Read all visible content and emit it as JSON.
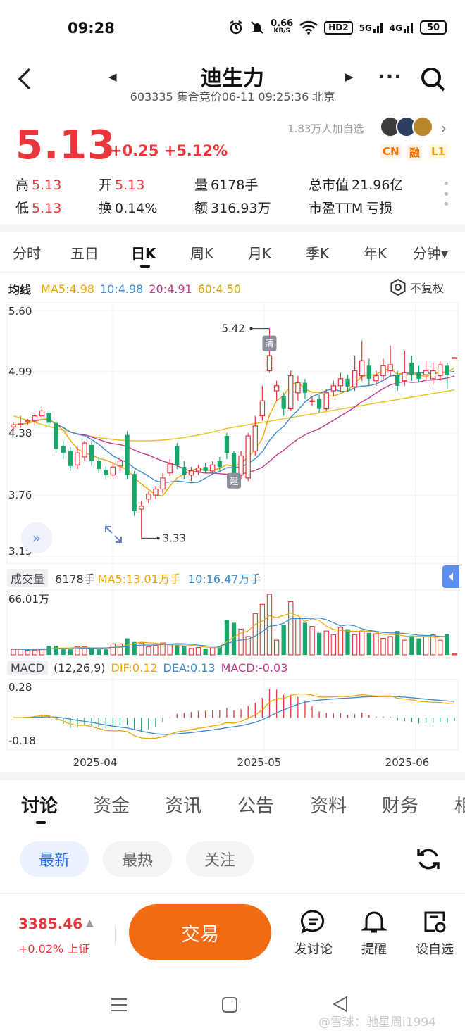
{
  "status_bar": {
    "time": "09:28",
    "net_speed": "0.66",
    "net_unit": "KB/S",
    "hd": "HD2",
    "sig1": "5G",
    "sig2": "4G",
    "battery": "50",
    "icons": [
      "alarm-icon",
      "mute-icon",
      "wifi-icon"
    ]
  },
  "header": {
    "stock_name": "迪生力",
    "subtitle": "603335 集合竞价06-11 09:25:36 北京"
  },
  "quote": {
    "price": "5.13",
    "change": "+0.25 +5.12%",
    "followers": "1.83万人加自选",
    "tags": [
      "CN",
      "融",
      "L1"
    ],
    "stats": {
      "high_label": "高",
      "high": "5.13",
      "open_label": "开",
      "open": "5.13",
      "volume_label": "量",
      "volume": "6178手",
      "mktcap_label": "总市值",
      "mktcap": "21.96亿",
      "low_label": "低",
      "low": "5.13",
      "turnover_label": "换",
      "turnover": "0.14%",
      "amount_label": "额",
      "amount": "316.93万",
      "pe_label": "市盈TTM",
      "pe": "亏损"
    },
    "colors": {
      "up": "#e8363a",
      "down": "#1aa56b"
    }
  },
  "period_tabs": [
    "分时",
    "五日",
    "日K",
    "周K",
    "月K",
    "季K",
    "年K",
    "分钟▾"
  ],
  "active_period": "日K",
  "ma_legend": {
    "label": "均线",
    "ma5": "MA5:4.98",
    "ma10": "10:4.98",
    "ma20": "20:4.91",
    "ma60": "60:4.50",
    "colors": {
      "ma5": "#f0a400",
      "ma10": "#3a8ad0",
      "ma20": "#c43a8c",
      "ma60": "#e8c020"
    },
    "adjust": "不复权"
  },
  "chart_data": {
    "type": "candlestick",
    "y_axis_labels": [
      "5.60",
      "4.99",
      "4.38",
      "3.76",
      "3.15"
    ],
    "ylim": [
      3.15,
      5.6
    ],
    "max_marker": "5.42",
    "min_marker": "3.33",
    "badges": [
      "清",
      "建"
    ],
    "x_labels": [
      "2025-04",
      "2025-05",
      "2025-06"
    ],
    "candles": [
      [
        4.44,
        4.46,
        4.4,
        4.48
      ],
      [
        4.47,
        4.47,
        4.43,
        4.55
      ],
      [
        4.49,
        4.5,
        4.46,
        4.52
      ],
      [
        4.5,
        4.55,
        4.45,
        4.58
      ],
      [
        4.55,
        4.6,
        4.5,
        4.65
      ],
      [
        4.58,
        4.48,
        4.45,
        4.6
      ],
      [
        4.48,
        4.22,
        4.18,
        4.5
      ],
      [
        4.25,
        4.18,
        4.12,
        4.3
      ],
      [
        4.2,
        4.05,
        4.0,
        4.24
      ],
      [
        4.06,
        4.18,
        4.02,
        4.24
      ],
      [
        4.14,
        4.28,
        4.1,
        4.3
      ],
      [
        4.26,
        4.1,
        4.05,
        4.3
      ],
      [
        4.1,
        4.02,
        3.98,
        4.14
      ],
      [
        4.01,
        3.96,
        3.92,
        4.05
      ],
      [
        3.96,
        4.04,
        3.94,
        4.08
      ],
      [
        4.05,
        4.1,
        4.0,
        4.14
      ],
      [
        4.36,
        3.96,
        3.92,
        4.4
      ],
      [
        3.97,
        3.6,
        3.55,
        4.0
      ],
      [
        3.62,
        3.65,
        3.33,
        3.7
      ],
      [
        3.72,
        3.77,
        3.68,
        3.8
      ],
      [
        3.76,
        3.82,
        3.72,
        3.85
      ],
      [
        3.82,
        3.93,
        3.78,
        3.98
      ],
      [
        3.98,
        4.07,
        3.95,
        4.12
      ],
      [
        4.25,
        4.06,
        4.02,
        4.28
      ],
      [
        4.04,
        3.96,
        3.92,
        4.1
      ],
      [
        3.96,
        4.0,
        3.9,
        4.04
      ],
      [
        4.0,
        4.03,
        3.96,
        4.06
      ],
      [
        4.04,
        4.0,
        3.98,
        4.08
      ],
      [
        4.0,
        4.06,
        3.97,
        4.1
      ],
      [
        4.1,
        4.04,
        4.0,
        4.14
      ],
      [
        4.35,
        4.18,
        4.12,
        4.38
      ],
      [
        4.18,
        3.96,
        3.92,
        4.2
      ],
      [
        3.96,
        4.15,
        3.92,
        4.2
      ],
      [
        3.93,
        4.35,
        3.9,
        4.38
      ],
      [
        4.2,
        4.45,
        4.15,
        4.55
      ],
      [
        4.55,
        4.7,
        4.5,
        4.85
      ],
      [
        5.0,
        5.15,
        4.98,
        5.42
      ],
      [
        4.8,
        4.85,
        4.7,
        4.9
      ],
      [
        4.75,
        4.62,
        4.55,
        4.78
      ],
      [
        4.62,
        4.95,
        4.6,
        5.0
      ],
      [
        4.78,
        4.88,
        4.7,
        4.95
      ],
      [
        4.88,
        4.78,
        4.72,
        4.92
      ],
      [
        4.7,
        4.7,
        4.65,
        4.75
      ],
      [
        4.72,
        4.62,
        4.58,
        4.76
      ],
      [
        4.62,
        4.78,
        4.6,
        4.82
      ],
      [
        4.8,
        4.85,
        4.75,
        4.9
      ],
      [
        4.85,
        4.92,
        4.8,
        4.98
      ],
      [
        4.92,
        4.84,
        4.8,
        4.96
      ],
      [
        4.84,
        5.0,
        4.8,
        5.15
      ],
      [
        4.95,
        5.1,
        4.9,
        5.3
      ],
      [
        5.05,
        4.92,
        4.85,
        5.12
      ],
      [
        4.9,
        4.95,
        4.85,
        5.0
      ],
      [
        4.95,
        5.05,
        4.9,
        5.12
      ],
      [
        5.0,
        5.06,
        4.95,
        5.25
      ],
      [
        4.96,
        4.85,
        4.8,
        5.0
      ],
      [
        4.9,
        4.98,
        4.85,
        5.2
      ],
      [
        5.08,
        4.96,
        4.9,
        5.15
      ],
      [
        4.98,
        4.92,
        4.88,
        5.05
      ],
      [
        4.96,
        5.0,
        4.9,
        5.1
      ],
      [
        4.92,
        5.0,
        4.86,
        5.08
      ],
      [
        4.95,
        5.06,
        4.9,
        5.1
      ],
      [
        5.05,
        4.96,
        4.82,
        5.08
      ],
      [
        5.13,
        5.13,
        5.13,
        5.13
      ]
    ]
  },
  "volume": {
    "label": "成交量",
    "current": "6178手",
    "ma5": "MA5:13.01万手",
    "ma10": "10:16.47万手",
    "max_label": "66.01万",
    "values": [
      6,
      6,
      5,
      5,
      6,
      10,
      10,
      6,
      6,
      9,
      9,
      8,
      6,
      6,
      12,
      12,
      18,
      14,
      13,
      9,
      10,
      13,
      11,
      11,
      10,
      7,
      8,
      7,
      8,
      10,
      38,
      35,
      28,
      20,
      45,
      55,
      66,
      16,
      33,
      58,
      40,
      35,
      31,
      24,
      26,
      22,
      30,
      28,
      22,
      26,
      24,
      23,
      18,
      20,
      26,
      16,
      21,
      18,
      20,
      22,
      16,
      23,
      1
    ]
  },
  "macd": {
    "label": "MACD",
    "params": "(12,26,9)",
    "dif": "DIF:0.12",
    "dea": "DEA:0.13",
    "macd": "MACD:-0.03",
    "top_label": "0.28",
    "bottom_label": "-0.18"
  },
  "info_tabs": [
    "讨论",
    "资金",
    "资讯",
    "公告",
    "资料",
    "财务",
    "相"
  ],
  "active_info_tab": "讨论",
  "filter_pills": [
    "最新",
    "最热",
    "关注"
  ],
  "bottom_bar": {
    "index_value": "3385.46",
    "index_change": "+0.02% 上证",
    "trade": "交易",
    "discuss": "发讨论",
    "remind": "提醒",
    "watch": "设自选"
  },
  "watermark": "@雪球：驰星周i1994"
}
